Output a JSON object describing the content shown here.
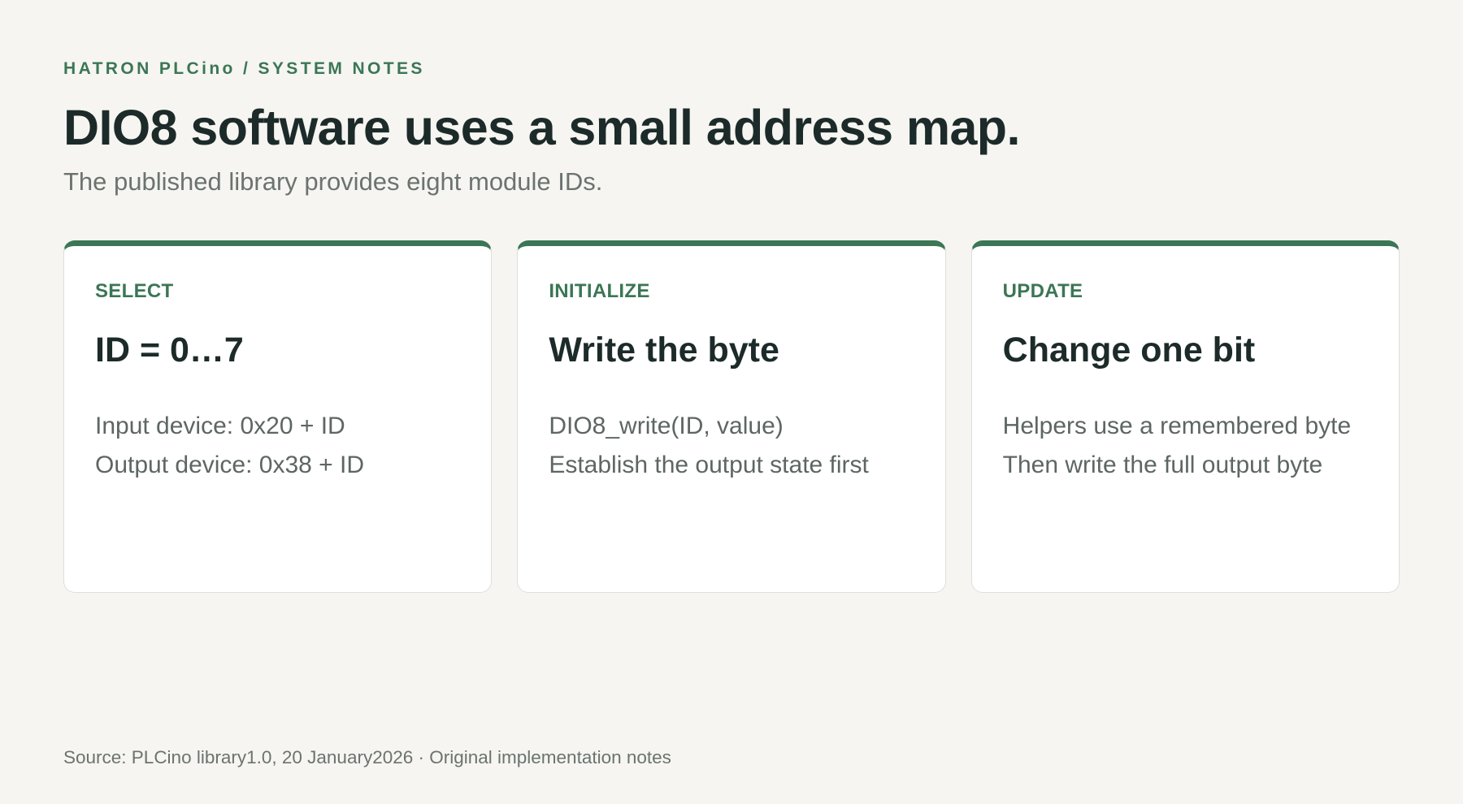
{
  "header": {
    "kicker": "HATRON PLCino / SYSTEM NOTES",
    "title": "DIO8 software uses a small address map.",
    "subtitle": "The published library provides eight module IDs."
  },
  "cards": [
    {
      "label": "SELECT",
      "heading": "ID = 0…7",
      "lines": [
        "Input device: 0x20 + ID",
        "Output device: 0x38 + ID"
      ]
    },
    {
      "label": "INITIALIZE",
      "heading": "Write the byte",
      "lines": [
        "DIO8_write(ID, value)",
        "Establish the output state first"
      ]
    },
    {
      "label": "UPDATE",
      "heading": "Change one bit",
      "lines": [
        "Helpers use a remembered byte",
        "Then write the full output byte"
      ]
    }
  ],
  "footer": {
    "source": "Source: PLCino library1.0, 20 January2026 · Original implementation notes"
  },
  "colors": {
    "accent": "#3b7655",
    "background": "#f6f5f1",
    "text": "#1c2b29"
  }
}
